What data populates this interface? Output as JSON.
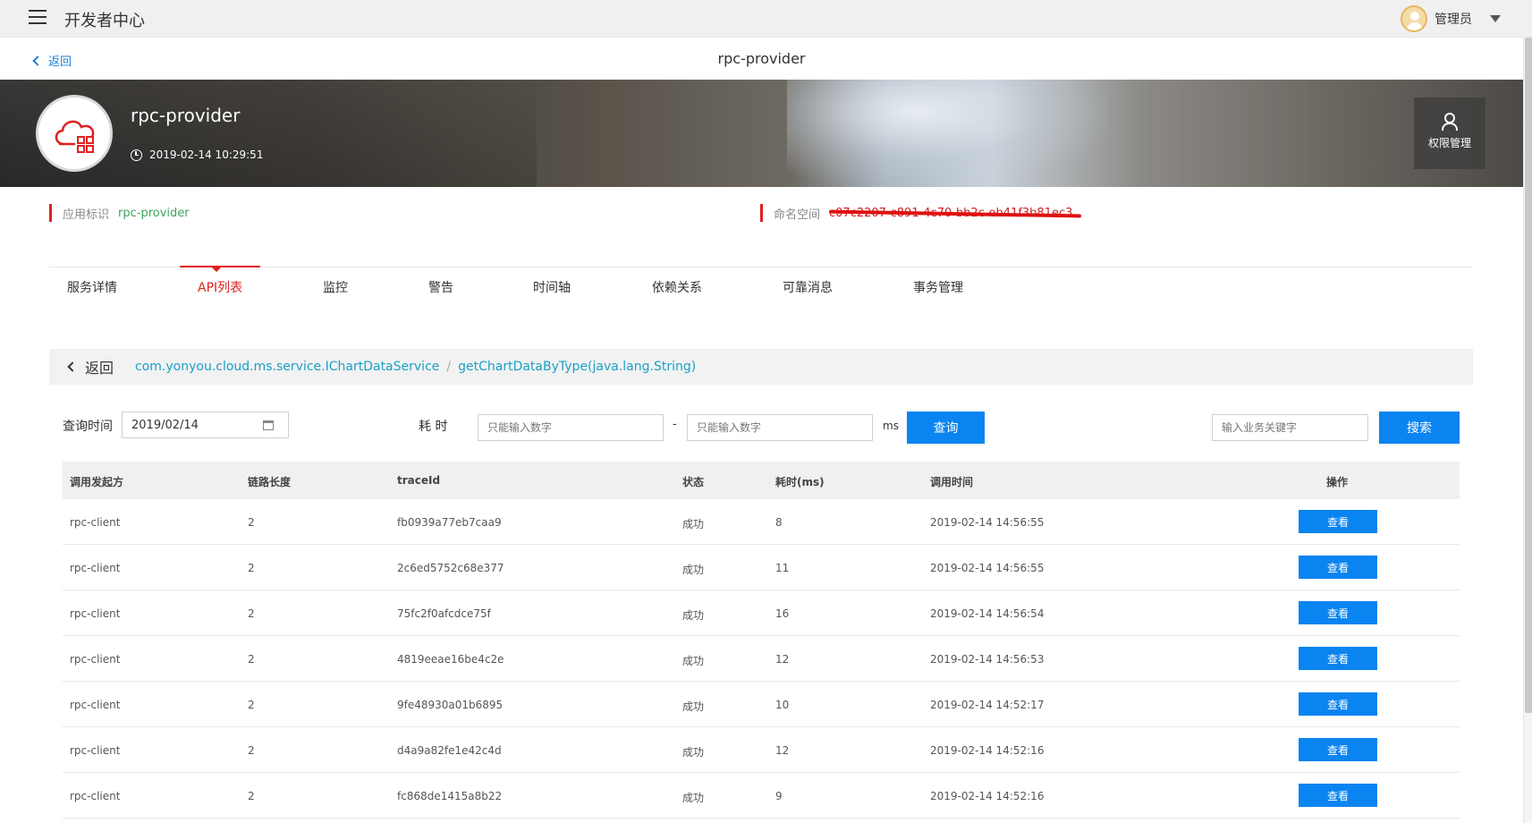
{
  "topbar": {
    "app_title": "开发者中心",
    "user_name": "管理员"
  },
  "header": {
    "back_label": "返回",
    "title": "rpc-provider"
  },
  "banner": {
    "app_name": "rpc-provider",
    "created_time": "2019-02-14 10:29:51",
    "perm_button_label": "权限管理"
  },
  "info": {
    "app_id_label": "应用标识",
    "app_id_value": "rpc-provider",
    "namespace_label": "命名空间",
    "namespace_value": "c07c2207-c891-4c70-bb2c-eb41f3b81ec3"
  },
  "tabs": [
    "服务详情",
    "API列表",
    "监控",
    "警告",
    "时间轴",
    "依赖关系",
    "可靠消息",
    "事务管理"
  ],
  "active_tab": "API列表",
  "breadcrumb": {
    "back_label": "返回",
    "service": "com.yonyou.cloud.ms.service.IChartDataService",
    "method": "getChartDataByType(java.lang.String)"
  },
  "query": {
    "time_label": "查询时间",
    "time_value": "2019/02/14",
    "duration_label": "耗 时",
    "min_placeholder": "只能输入数字",
    "dash": "-",
    "max_placeholder": "只能输入数字",
    "unit": "ms",
    "query_button": "查询",
    "keyword_placeholder": "输入业务关键字",
    "search_button": "搜索"
  },
  "table": {
    "columns": [
      "调用发起方",
      "链路长度",
      "traceId",
      "状态",
      "耗时(ms)",
      "调用时间",
      "操作"
    ],
    "view_label": "查看",
    "rows": [
      [
        "rpc-client",
        "2",
        "fb0939a77eb7caa9",
        "成功",
        "8",
        "2019-02-14 14:56:55"
      ],
      [
        "rpc-client",
        "2",
        "2c6ed5752c68e377",
        "成功",
        "11",
        "2019-02-14 14:56:55"
      ],
      [
        "rpc-client",
        "2",
        "75fc2f0afcdce75f",
        "成功",
        "16",
        "2019-02-14 14:56:54"
      ],
      [
        "rpc-client",
        "2",
        "4819eeae16be4c2e",
        "成功",
        "12",
        "2019-02-14 14:56:53"
      ],
      [
        "rpc-client",
        "2",
        "9fe48930a01b6895",
        "成功",
        "10",
        "2019-02-14 14:52:17"
      ],
      [
        "rpc-client",
        "2",
        "d4a9a82fe1e42c4d",
        "成功",
        "12",
        "2019-02-14 14:52:16"
      ],
      [
        "rpc-client",
        "2",
        "fc868de1415a8b22",
        "成功",
        "9",
        "2019-02-14 14:52:16"
      ]
    ]
  },
  "colors": {
    "accent_red": "#e02020",
    "primary_blue": "#0a84f0",
    "link_cyan": "#1aa0c8",
    "success_green": "#3aa35a"
  }
}
